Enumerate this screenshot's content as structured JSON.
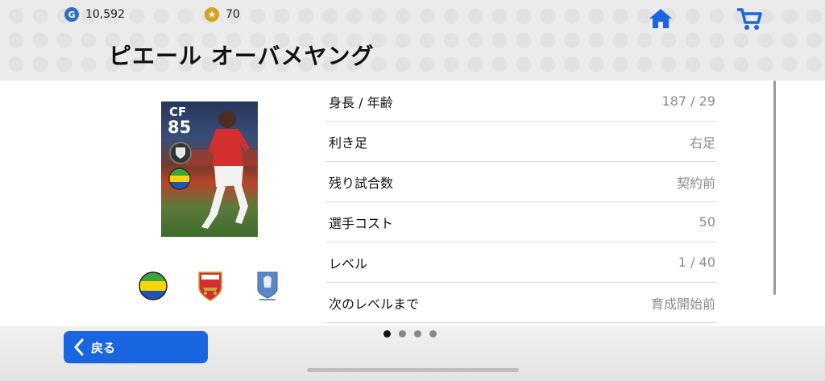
{
  "currency": {
    "gp": "10,592",
    "gp_icon": "G",
    "coins": "70",
    "coin_icon": "★"
  },
  "nav": {
    "home_icon": "home-icon",
    "cart_icon": "shopping-cart-icon"
  },
  "player": {
    "name": "ピエール オーバメヤング",
    "card_position": "CF",
    "card_rating": "85"
  },
  "info_icons": [
    "nationality-flag-icon",
    "club-crest-icon",
    "league-emblem-icon"
  ],
  "stats": [
    {
      "label": "身長 / 年齢",
      "value": "187 / 29"
    },
    {
      "label": "利き足",
      "value": "右足"
    },
    {
      "label": "残り試合数",
      "value": "契約前"
    },
    {
      "label": "選手コスト",
      "value": "50"
    },
    {
      "label": "レベル",
      "value": "1 / 40"
    },
    {
      "label": "次のレベルまで",
      "value": "育成開始前"
    }
  ],
  "footer": {
    "back_label": "戻る",
    "page_count": 4,
    "active_page": 1
  },
  "colors": {
    "accent": "#1a66e0",
    "header_bg": "#ebebeb"
  }
}
